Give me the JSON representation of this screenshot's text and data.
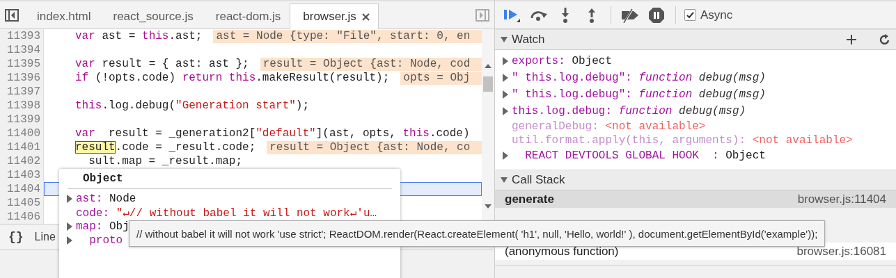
{
  "editor": {
    "tabs": [
      {
        "label": "index.html",
        "selected": false,
        "closable": false
      },
      {
        "label": "react_source.js",
        "selected": false,
        "closable": false
      },
      {
        "label": "react-dom.js",
        "selected": false,
        "closable": false
      },
      {
        "label": "browser.js",
        "selected": true,
        "closable": true
      }
    ],
    "lines": [
      {
        "number": "11393",
        "current": false,
        "tokens": [
          {
            "kind": "keyword",
            "text": "var"
          },
          {
            "kind": "plain",
            "text": " ast = "
          },
          {
            "kind": "keyword",
            "text": "this"
          },
          {
            "kind": "plain",
            "text": ".ast;"
          }
        ],
        "annotation": "ast = Node {type: \"File\", start: 0, en"
      },
      {
        "number": "11394",
        "current": false
      },
      {
        "number": "11395",
        "current": false,
        "tokens": [
          {
            "kind": "keyword",
            "text": "var"
          },
          {
            "kind": "plain",
            "text": " result = { ast: ast };"
          }
        ],
        "annotation": "result = Object {ast: Node, cod"
      },
      {
        "number": "11396",
        "current": false,
        "tokens": [
          {
            "kind": "keyword",
            "text": "if"
          },
          {
            "kind": "plain",
            "text": " (!opts.code) "
          },
          {
            "kind": "keyword",
            "text": "return this"
          },
          {
            "kind": "plain",
            "text": ".makeResult(result);"
          }
        ],
        "annotation": "opts = Obj"
      },
      {
        "number": "11397",
        "current": false
      },
      {
        "number": "11398",
        "current": false,
        "tokens": [
          {
            "kind": "keyword",
            "text": "this"
          },
          {
            "kind": "plain",
            "text": ".log.debug("
          },
          {
            "kind": "string",
            "text": "\"Generation start\""
          },
          {
            "kind": "plain",
            "text": ");"
          }
        ]
      },
      {
        "number": "11399",
        "current": false
      },
      {
        "number": "11400",
        "current": false,
        "tokens": [
          {
            "kind": "keyword",
            "text": "var"
          },
          {
            "kind": "plain",
            "text": "  result = _generation2["
          },
          {
            "kind": "string",
            "text": "\"default\""
          },
          {
            "kind": "plain",
            "text": "](ast, opts, "
          },
          {
            "kind": "keyword",
            "text": "this"
          },
          {
            "kind": "plain",
            "text": ".code)"
          }
        ]
      },
      {
        "number": "11401",
        "current": false,
        "tokens": [
          {
            "kind": "hover",
            "text": "result"
          },
          {
            "kind": "plain",
            "text": ".code = _result.code;"
          }
        ],
        "annotation": "result = Object {ast: Node, co"
      },
      {
        "number": "11402",
        "current": false,
        "tokens": [
          {
            "kind": "plain",
            "text": "  sult.map = _result.map;"
          }
        ]
      },
      {
        "number": "11403",
        "current": false
      },
      {
        "number": "11404",
        "current": true
      },
      {
        "number": "11405",
        "current": false
      },
      {
        "number": "11406",
        "current": false
      }
    ],
    "status": {
      "format_button": "{}",
      "position": "Line"
    }
  },
  "popover": {
    "title": "Object",
    "rows": [
      {
        "key": "ast:",
        "value": "Node",
        "kind": "object",
        "expandable": true
      },
      {
        "key": "code:",
        "value": "\"↵// without babel it will not work↵'u…",
        "kind": "string",
        "expandable": false
      },
      {
        "key": "map:",
        "value": "Obj",
        "kind": "object",
        "expandable": true
      },
      {
        "key": "  proto",
        "expandable": true
      }
    ]
  },
  "tooltip": "// without babel it will not work 'use strict'; ReactDOM.render(React.createElement( 'h1', null, 'Hello, world!' ), document.getElementById('example'));",
  "debugger": {
    "async": {
      "label": "Async",
      "checked": true
    },
    "watch": {
      "title": "Watch",
      "expanded": true,
      "items": [
        {
          "key": "exports:",
          "kind": "object",
          "value": "Object",
          "expandable": true
        },
        {
          "key": "\" this.log.debug\":",
          "kind": "function",
          "keyword": "function",
          "value": "debug(msg)",
          "expandable": true
        },
        {
          "key": "\" this.log.debug\":",
          "kind": "function",
          "keyword": "function",
          "value": "debug(msg)",
          "expandable": true
        },
        {
          "key": "this.log.debug:",
          "kind": "function",
          "keyword": "function",
          "value": "debug(msg)",
          "expandable": true
        },
        {
          "key": "generalDebug:",
          "kind": "unavailable",
          "value": "<not available>",
          "expandable": false
        },
        {
          "key": "util.format.apply(this, arguments):",
          "kind": "unavailable",
          "value": "<not available>",
          "expandable": false
        },
        {
          "key": "  REACT DEVTOOLS GLOBAL HOOK  :",
          "kind": "object",
          "value": "Object",
          "expandable": true
        }
      ]
    },
    "call_stack": {
      "title": "Call Stack",
      "expanded": true,
      "frames": [
        {
          "name": "generate",
          "location": "browser.js:11404",
          "selected": true
        },
        {
          "name": "(anonymous function)",
          "location": "browser.js:16081",
          "selected": false
        }
      ]
    }
  }
}
